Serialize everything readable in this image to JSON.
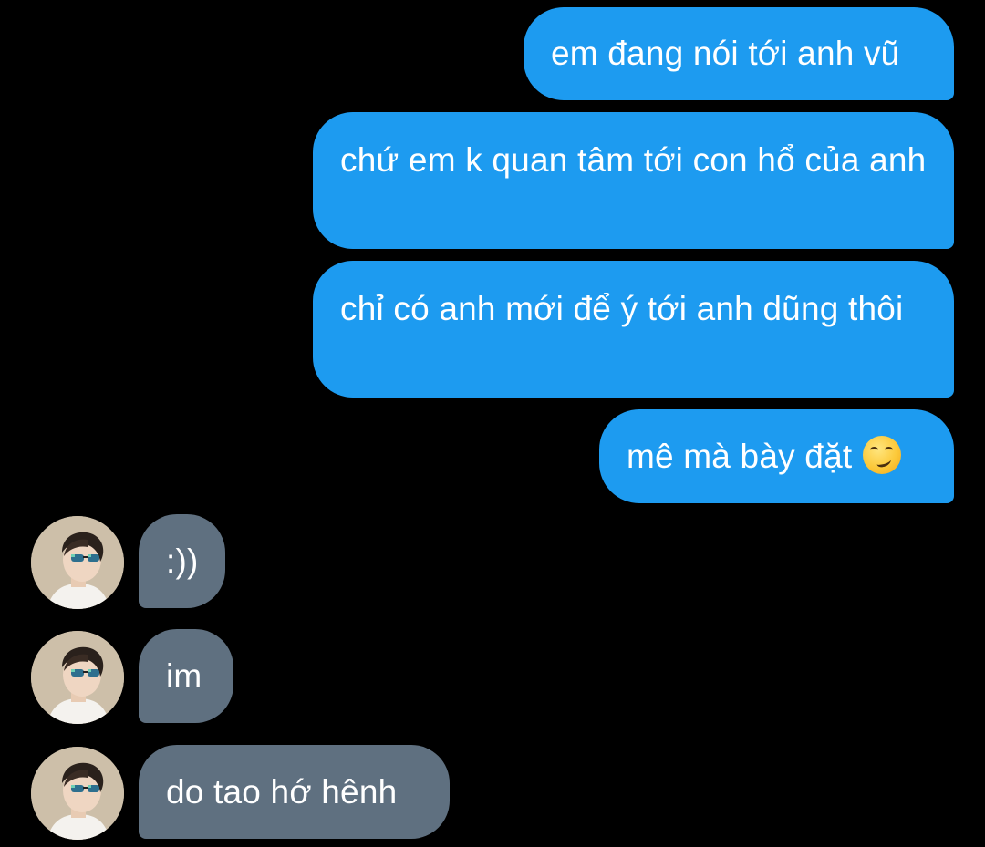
{
  "conversation": {
    "messages": [
      {
        "direction": "outgoing",
        "text": "em đang nói tới anh vũ"
      },
      {
        "direction": "outgoing",
        "text": "chứ em k quan tâm tới con hổ của anh"
      },
      {
        "direction": "outgoing",
        "text": "chỉ có anh mới để ý tới anh dũng thôi"
      },
      {
        "direction": "outgoing",
        "text": "mê mà bày đặt",
        "emoji": "smirking-face-icon"
      },
      {
        "direction": "incoming",
        "text": ":))",
        "avatar": "contact-avatar"
      },
      {
        "direction": "incoming",
        "text": "im",
        "avatar": "contact-avatar"
      },
      {
        "direction": "incoming",
        "text": "do tao hớ hênh",
        "avatar": "contact-avatar"
      }
    ]
  },
  "colors": {
    "background": "#000000",
    "outgoing_bubble": "#1d9bf0",
    "incoming_bubble": "#5f7080",
    "text": "#ffffff"
  }
}
